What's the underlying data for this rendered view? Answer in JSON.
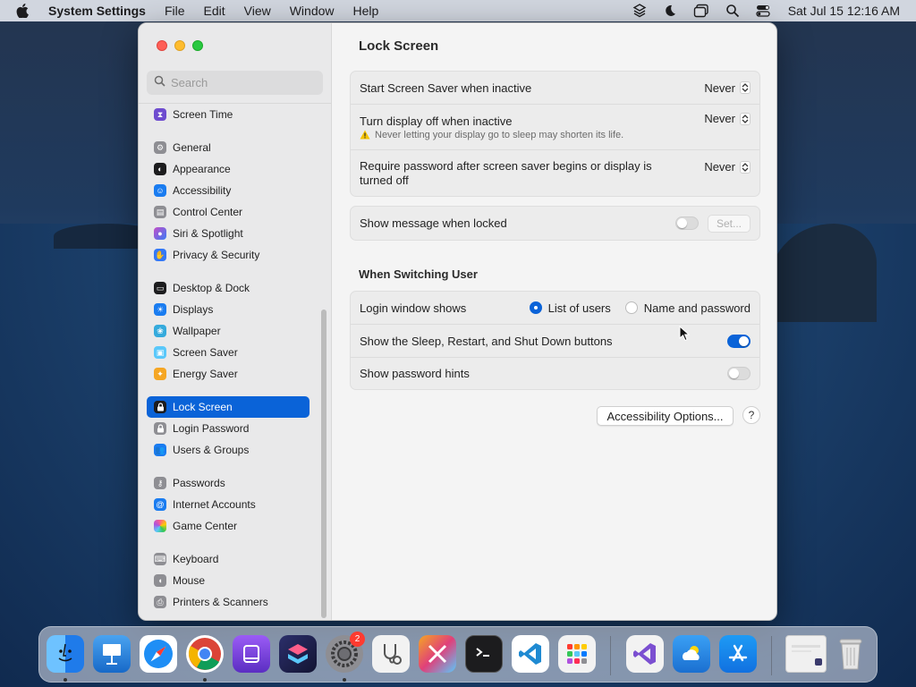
{
  "menubar": {
    "app_name": "System Settings",
    "items": [
      "File",
      "Edit",
      "View",
      "Window",
      "Help"
    ],
    "clock": "Sat Jul 15  12:16 AM"
  },
  "sidebar": {
    "search_placeholder": "Search",
    "items": [
      {
        "label": "Screen Time",
        "color": "#6e4ccf"
      },
      {
        "label": "General",
        "color": "#8e8e93"
      },
      {
        "label": "Appearance",
        "color": "#1c1c1e"
      },
      {
        "label": "Accessibility",
        "color": "#1a7cf0"
      },
      {
        "label": "Control Center",
        "color": "#8e8e93"
      },
      {
        "label": "Siri & Spotlight",
        "color": "#c44fc8"
      },
      {
        "label": "Privacy & Security",
        "color": "#3478f6"
      },
      {
        "label": "Desktop & Dock",
        "color": "#1c1c1e"
      },
      {
        "label": "Displays",
        "color": "#1a7cf0"
      },
      {
        "label": "Wallpaper",
        "color": "#35aadc"
      },
      {
        "label": "Screen Saver",
        "color": "#5ac8fa"
      },
      {
        "label": "Energy Saver",
        "color": "#f5a623"
      },
      {
        "label": "Lock Screen",
        "color": "#1c1c1e"
      },
      {
        "label": "Login Password",
        "color": "#8e8e93"
      },
      {
        "label": "Users & Groups",
        "color": "#1a7cf0"
      },
      {
        "label": "Passwords",
        "color": "#8e8e93"
      },
      {
        "label": "Internet Accounts",
        "color": "#1a7cf0"
      },
      {
        "label": "Game Center",
        "color": "#e8e8e8"
      },
      {
        "label": "Keyboard",
        "color": "#8e8e93"
      },
      {
        "label": "Mouse",
        "color": "#8e8e93"
      },
      {
        "label": "Printers & Scanners",
        "color": "#8e8e93"
      }
    ],
    "selected": "Lock Screen"
  },
  "main": {
    "title": "Lock Screen",
    "group1": {
      "screen_saver_label": "Start Screen Saver when inactive",
      "screen_saver_value": "Never",
      "display_off_label": "Turn display off when inactive",
      "display_off_value": "Never",
      "display_off_warning": "Never letting your display go to sleep may shorten its life.",
      "require_password_label": "Require password after screen saver begins or display is turned off",
      "require_password_value": "Never"
    },
    "group2": {
      "show_message_label": "Show message when locked",
      "show_message_on": false,
      "set_button": "Set..."
    },
    "switching_title": "When Switching User",
    "group3": {
      "login_window_label": "Login window shows",
      "option_list": "List of users",
      "option_name": "Name and password",
      "selected_option": "List of users",
      "sleep_buttons_label": "Show the Sleep, Restart, and Shut Down buttons",
      "sleep_buttons_on": true,
      "password_hints_label": "Show password hints",
      "password_hints_on": false
    },
    "accessibility_button": "Accessibility Options...",
    "help_button": "?"
  },
  "dock": {
    "apps": [
      "Finder",
      "Keynote",
      "Safari",
      "Chrome",
      "Podcasts",
      "Shortcuts",
      "System Settings",
      "Stethoscope",
      "Utility",
      "Terminal",
      "VS Code",
      "Launchpad",
      "Visual Studio",
      "Weather",
      "App Store",
      "Window Preview",
      "Trash"
    ],
    "system_settings_badge": "2"
  },
  "colors": {
    "accent": "#0a63d8",
    "window_bg": "#f4f4f4",
    "sidebar_bg": "#e9e9ea"
  }
}
